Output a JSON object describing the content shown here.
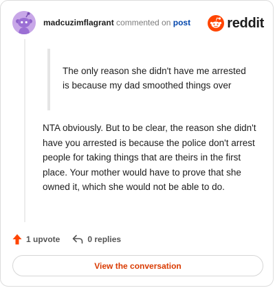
{
  "header": {
    "username": "madcuzimflagrant",
    "action_text": "commented on",
    "post_link": "post",
    "logo_text": "reddit"
  },
  "comment": {
    "quote": "The only reason she didn't have me arrested is because my dad smoothed things over",
    "body": "NTA obviously. But to be clear, the reason she didn't have you arrested is because the police don't arrest people for taking things that are theirs in the first place. Your mother would have to prove that she owned it, which she would not be able to do."
  },
  "actions": {
    "upvotes": "1 upvote",
    "replies": "0 replies"
  },
  "view_button": "View the conversation",
  "colors": {
    "brand": "#ff4500",
    "button_text": "#d93a00",
    "link": "#0045ac",
    "avatar_bg": "#c8a7e8"
  },
  "icons": {
    "avatar": "snoo-avatar-icon",
    "logo": "reddit-logo-icon",
    "upvote": "upvote-arrow-icon",
    "reply": "reply-arrow-icon"
  }
}
